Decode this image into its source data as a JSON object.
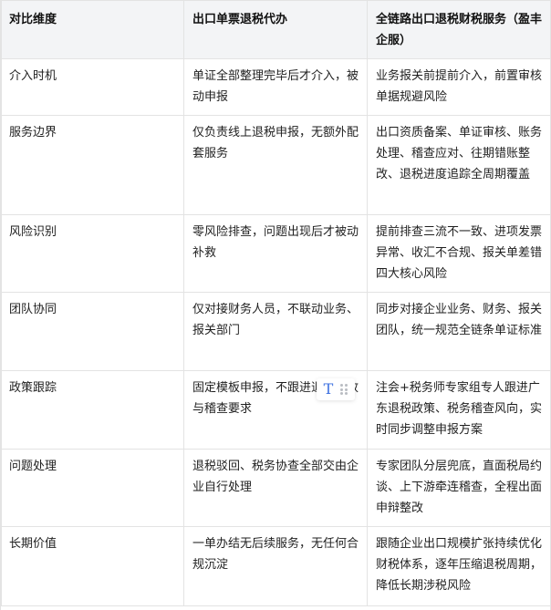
{
  "table": {
    "headers": [
      "对比维度",
      "出口单票退税代办",
      "全链路出口退税财税服务（盈丰企服）"
    ],
    "rows": [
      [
        "介入时机",
        "单证全部整理完毕后才介入，被动申报",
        "业务报关前提前介入，前置审核单据规避风险"
      ],
      [
        "服务边界",
        "仅负责线上退税申报，无额外配套服务",
        "出口资质备案、单证审核、账务处理、稽查应对、往期错账整改、退税进度追踪全周期覆盖"
      ],
      [
        "风险识别",
        "零风险排查，问题出现后才被动补救",
        "提前排查三流不一致、进项发票异常、收汇不合规、报关单差错四大核心风险"
      ],
      [
        "团队协同",
        "仅对接财务人员，不联动业务、报关部门",
        "同步对接企业业务、财务、报关团队，统一规范全链条单证标准"
      ],
      [
        "政策跟踪",
        "固定模板申报，不跟进退税新政与稽查要求",
        "注会+税务师专家组专人跟进广东退税政策、税务稽查风向，实时同步调整申报方案"
      ],
      [
        "问题处理",
        "退税驳回、税务协查全部交由企业自行处理",
        "专家团队分层兜底，直面税局约谈、上下游牵连稽查，全程出面申辩整改"
      ],
      [
        "长期价值",
        "一单办结无后续服务，无任何合规沉淀",
        "跟随企业出口规模扩张持续优化财税体系，逐年压缩退税周期，降低长期涉税风险"
      ]
    ]
  },
  "floating_toolbar": {
    "text_tool_glyph": "T",
    "text_tool_icon": "text-format-icon",
    "drag_icon": "drag-handle-icon",
    "accent_color": "#3b6fe0"
  },
  "colors": {
    "header_bg": "#f3f4f6",
    "border": "#e3e3e3"
  }
}
